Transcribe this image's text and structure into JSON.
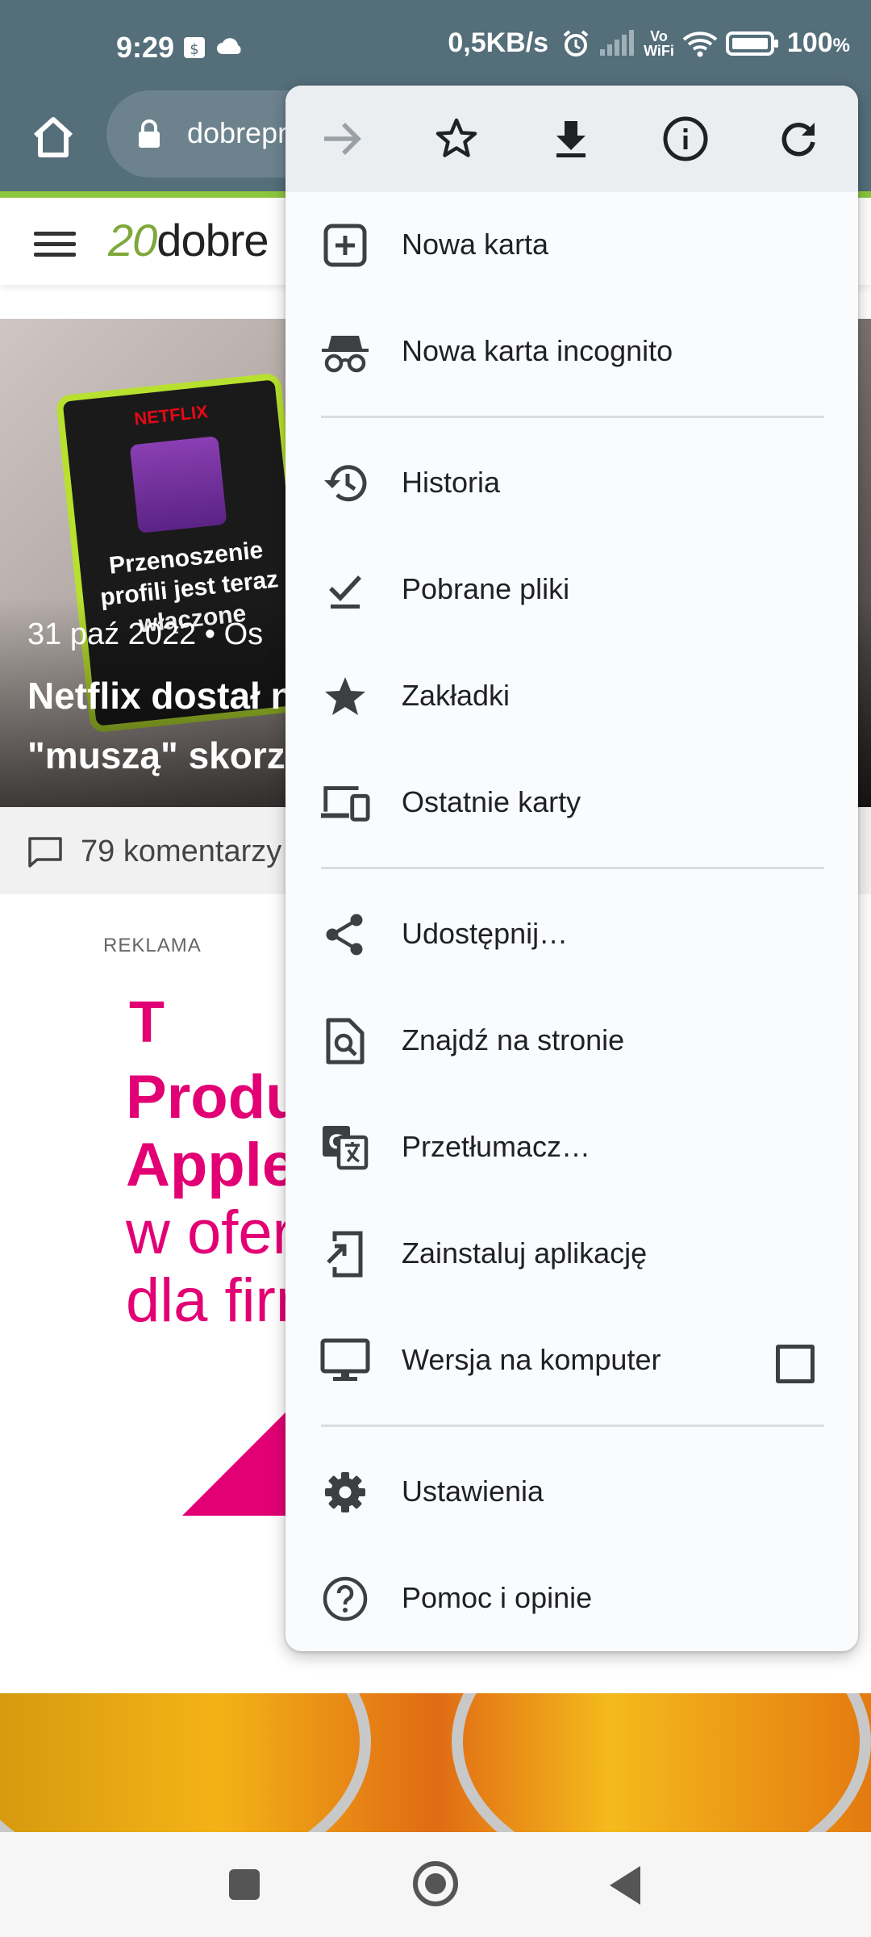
{
  "status_bar": {
    "time": "9:29",
    "speed": "0,5KB/s",
    "vowifi_top": "Vo",
    "vowifi_bottom": "WiFi",
    "battery": "100",
    "battery_unit": "%"
  },
  "browser": {
    "url": "dobrepr"
  },
  "site": {
    "logo_num": "20",
    "logo_text": "dobre"
  },
  "article": {
    "phone_brand": "NETFLIX",
    "phone_text": "Przenoszenie profili jest teraz włączone",
    "date": "31 paź 2022  •  Os",
    "title_line1": "Netflix dostał n",
    "title_line2": "\"muszą\" skorzy",
    "comments": "79 komentarzy"
  },
  "ad": {
    "label": "REKLAMA",
    "logo": "T",
    "line1": "Produ",
    "line2": "Apple",
    "line3": "w oferc",
    "line4": "dla firm"
  },
  "menu": {
    "top_icons": [
      "forward-icon",
      "star-icon",
      "download-icon",
      "info-icon",
      "reload-icon"
    ],
    "items": [
      {
        "label": "Nowa karta",
        "icon": "new-tab-icon"
      },
      {
        "label": "Nowa karta incognito",
        "icon": "incognito-icon"
      },
      {
        "label": "Historia",
        "icon": "history-icon"
      },
      {
        "label": "Pobrane pliki",
        "icon": "downloads-icon"
      },
      {
        "label": "Zakładki",
        "icon": "bookmarks-icon"
      },
      {
        "label": "Ostatnie karty",
        "icon": "recent-tabs-icon"
      },
      {
        "label": "Udostępnij…",
        "icon": "share-icon"
      },
      {
        "label": "Znajdź na stronie",
        "icon": "find-in-page-icon"
      },
      {
        "label": "Przetłumacz…",
        "icon": "translate-icon"
      },
      {
        "label": "Zainstaluj aplikację",
        "icon": "install-app-icon"
      },
      {
        "label": "Wersja na komputer",
        "icon": "desktop-icon",
        "checked": false
      },
      {
        "label": "Ustawienia",
        "icon": "settings-icon"
      },
      {
        "label": "Pomoc i opinie",
        "icon": "help-icon"
      }
    ]
  },
  "colors": {
    "toolbar": "#546e7a",
    "accent_green": "#8dc63f",
    "tmobile_magenta": "#e20074",
    "icon": "#3c4043"
  }
}
